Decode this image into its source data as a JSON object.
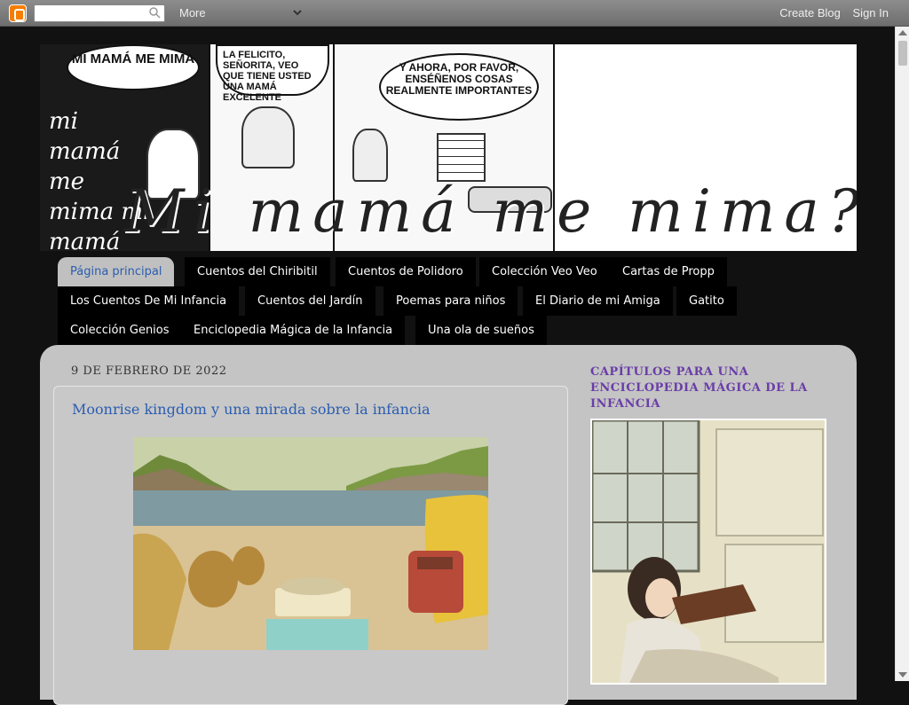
{
  "navbar": {
    "search_placeholder": "",
    "more_label": "More",
    "create_blog": "Create Blog",
    "sign_in": "Sign In"
  },
  "header": {
    "bubble1": "MI MAMÁ ME MIMA",
    "bubble2": "LA FELICITO, SEÑORITA, VEO QUE TIENE USTED UNA MAMÁ EXCELENTE",
    "bubble3": "Y AHORA, POR FAVOR, ENSÉÑENOS COSAS REALMENTE IMPORTANTES",
    "scribble": "mi mamá me mima mi mamá",
    "title": "Mi mamá me mima?"
  },
  "tabs": [
    {
      "label": "Página principal"
    },
    {
      "label": "Cuentos del Chiribitil"
    },
    {
      "label": "Cuentos de Polidoro"
    },
    {
      "label": "Colección Veo Veo"
    },
    {
      "label": "Cartas de Propp"
    },
    {
      "label": "Los Cuentos De Mi Infancia"
    },
    {
      "label": "Cuentos del Jardín"
    },
    {
      "label": "Poemas para niños"
    },
    {
      "label": "El Diario de mi Amiga"
    },
    {
      "label": "Gatito"
    },
    {
      "label": "Colección Genios"
    },
    {
      "label": "Enciclopedia Mágica de la Infancia"
    },
    {
      "label": "Una ola de sueños"
    }
  ],
  "post": {
    "date": "9 DE FEBRERO DE 2022",
    "title": "Moonrise kingdom y una mirada sobre la infancia"
  },
  "sidebar": {
    "title": "CAPÍTULOS PARA UNA ENCICLOPEDIA MÁGICA DE LA INFANCIA"
  },
  "colors": {
    "accent": "#2a5db0",
    "sidebar_title": "#6a3da8",
    "background": "#111111",
    "content_bg": "#c4c4c4"
  }
}
